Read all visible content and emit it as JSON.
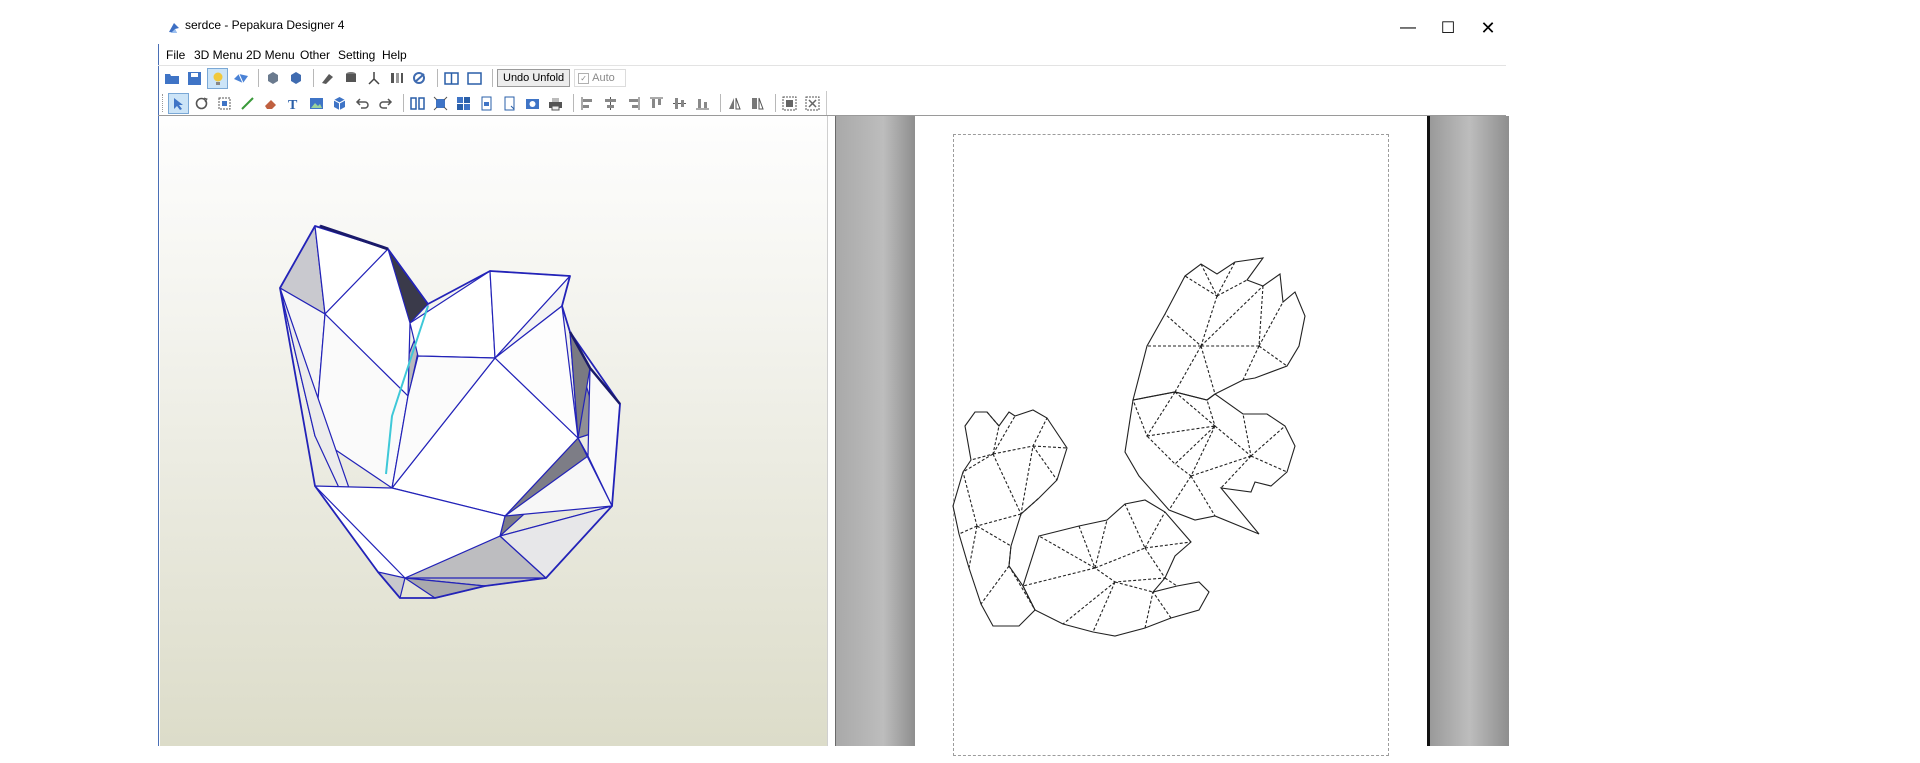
{
  "window": {
    "title": "serdce - Pepakura Designer 4",
    "controls": {
      "minimize": "—",
      "maximize": "☐",
      "close": "✕"
    }
  },
  "menu": {
    "items": [
      {
        "label": "File"
      },
      {
        "label": "3D Menu"
      },
      {
        "label": "2D Menu"
      },
      {
        "label": "Other"
      },
      {
        "label": "Setting"
      },
      {
        "label": "Help"
      }
    ]
  },
  "toolbar1": {
    "undo_unfold_label": "Undo Unfold",
    "auto_label": "Auto",
    "auto_checked": "✓"
  },
  "colors": {
    "accent": "#2a5fa8",
    "model_edge": "#2323b8",
    "cut_edge": "#3ec8d8",
    "pattern_line": "#222222"
  },
  "icons": {
    "toolbar1": [
      "open-icon",
      "save-icon",
      "light-icon",
      "unfold-icon",
      "view-front-icon",
      "view-back-icon",
      "texture-icon",
      "cylinder-icon",
      "axis-icon",
      "flap-icon",
      "link-icon",
      "split-view-icon",
      "single-view-icon"
    ],
    "toolbar2": [
      "select-icon",
      "rotate-icon",
      "join-icon",
      "draw-line-icon",
      "erase-icon",
      "text-icon",
      "image-icon",
      "cube-icon",
      "undo-icon",
      "redo-icon",
      "layout-icon",
      "fit-icon",
      "grid-icon",
      "page-icon",
      "page-add-icon",
      "camera-icon",
      "print-icon",
      "align-left-icon",
      "align-center-icon",
      "align-right-icon",
      "align-top-icon",
      "align-middle-icon",
      "align-bottom-icon",
      "flip-h-icon",
      "flip-v-icon",
      "group-icon",
      "ungroup-icon"
    ]
  }
}
